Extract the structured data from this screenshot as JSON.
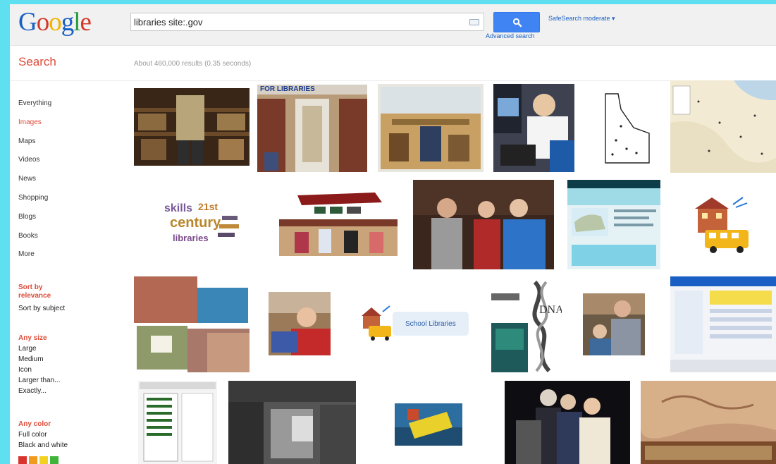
{
  "logo": {
    "letters": [
      "G",
      "o",
      "o",
      "g",
      "l",
      "e"
    ],
    "colors": [
      "#1a5fc4",
      "#d23b2a",
      "#f0b400",
      "#1a5fc4",
      "#2a9a3f",
      "#d23b2a"
    ]
  },
  "search": {
    "query": "libraries site:.gov",
    "button_icon": "magnifier-icon",
    "advanced_link": "Advanced search",
    "safesearch": "SafeSearch moderate ▾"
  },
  "results": {
    "label": "Search",
    "stats": "About 460,000 results (0.35 seconds)"
  },
  "nav": [
    "Everything",
    "Images",
    "Maps",
    "Videos",
    "News",
    "Shopping",
    "Blogs",
    "Books",
    "More"
  ],
  "nav_active": "Images",
  "sort": {
    "relevance": "Sort by relevance",
    "subject": "Sort by subject"
  },
  "size": {
    "heading": "Any size",
    "options": [
      "Large",
      "Medium",
      "Icon",
      "Larger than...",
      "Exactly..."
    ]
  },
  "color": {
    "heading": "Any color",
    "options": [
      "Full color",
      "Black and white"
    ],
    "swatches": [
      "#d9342b",
      "#f29a1e",
      "#f2d21e",
      "#3fb33a"
    ]
  },
  "thumbnails": {
    "caption_for_libraries": "FOR LIBRARIES",
    "school_libraries_label": "School Libraries",
    "wordcloud": [
      "skills",
      "21st",
      "century",
      "libraries"
    ],
    "dna_label": "DNA"
  },
  "colors": {
    "accent_red": "#dd4b39",
    "link_blue": "#1a5fc4",
    "button_blue": "#3f84f2",
    "frame": "#5ee0f0"
  }
}
